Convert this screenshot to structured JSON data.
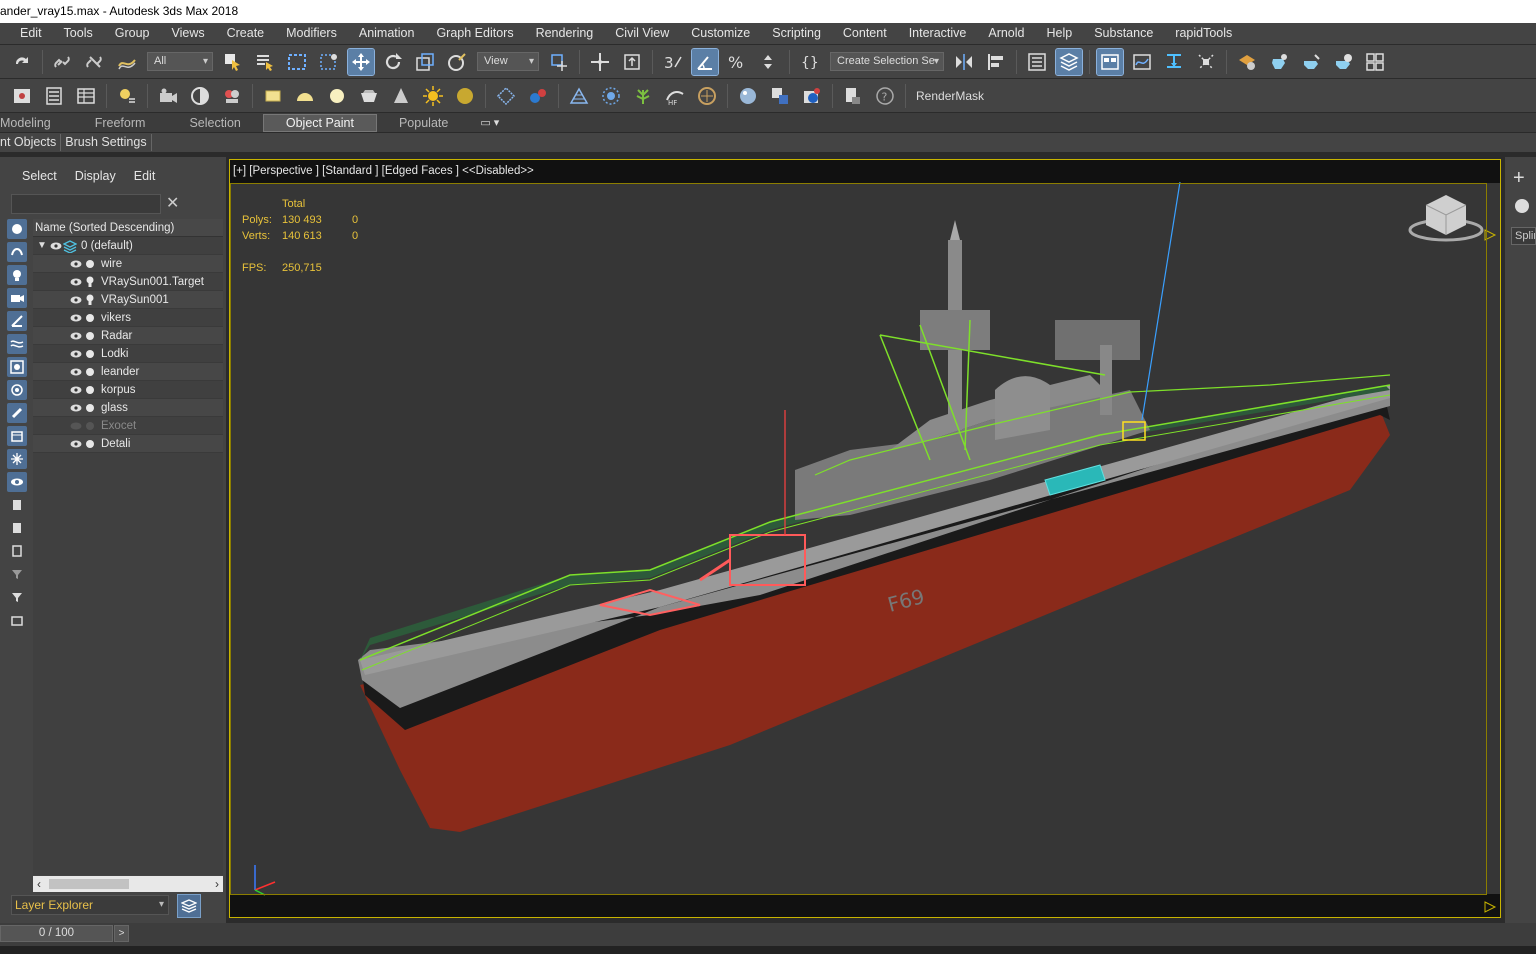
{
  "window": {
    "title": "ander_vray15.max - Autodesk 3ds Max 2018"
  },
  "menu": [
    "Edit",
    "Tools",
    "Group",
    "Views",
    "Create",
    "Modifiers",
    "Animation",
    "Graph Editors",
    "Rendering",
    "Civil View",
    "Customize",
    "Scripting",
    "Content",
    "Interactive",
    "Arnold",
    "Help",
    "Substance",
    "rapidTools"
  ],
  "toolbar": {
    "filter_value": "All",
    "refcoord_value": "View",
    "selection_set_value": "Create Selection Se",
    "render_mask_label": "RenderMask"
  },
  "ribbon": {
    "tabs": [
      "Modeling",
      "Freeform",
      "Selection",
      "Object Paint",
      "Populate"
    ],
    "active_tab": "Object Paint",
    "sub_tabs": [
      "nt Objects",
      "Brush Settings"
    ]
  },
  "explorer": {
    "tabs": [
      "Select",
      "Display",
      "Edit"
    ],
    "header": "Name (Sorted Descending)",
    "layer": "0 (default)",
    "items": [
      {
        "name": "wire",
        "type": "object",
        "visible": true
      },
      {
        "name": "VRaySun001.Target",
        "type": "light",
        "visible": true
      },
      {
        "name": "VRaySun001",
        "type": "light",
        "visible": true
      },
      {
        "name": "vikers",
        "type": "object",
        "visible": true
      },
      {
        "name": "Radar",
        "type": "object",
        "visible": true
      },
      {
        "name": "Lodki",
        "type": "object",
        "visible": true
      },
      {
        "name": "leander",
        "type": "object",
        "visible": true
      },
      {
        "name": "korpus",
        "type": "object",
        "visible": true
      },
      {
        "name": "glass",
        "type": "object",
        "visible": true
      },
      {
        "name": "Exocet",
        "type": "object",
        "visible": false
      },
      {
        "name": "Detali",
        "type": "object",
        "visible": true
      }
    ],
    "footer_dropdown": "Layer Explorer"
  },
  "viewport": {
    "label": "[+] [Perspective ] [Standard ] [Edged Faces ]  <<Disabled>>",
    "stats": {
      "total_label": "Total",
      "polys_label": "Polys:",
      "polys_total": "130 493",
      "polys_sel": "0",
      "verts_label": "Verts:",
      "verts_total": "140 613",
      "verts_sel": "0",
      "fps_label": "FPS:",
      "fps_value": "250,715"
    },
    "hull_number": "F69",
    "frame_color": "#c8b400",
    "stats_color": "#e8c23a"
  },
  "command_panel": {
    "dropdown": "Splin"
  },
  "timeline": {
    "slider": "0 / 100"
  }
}
